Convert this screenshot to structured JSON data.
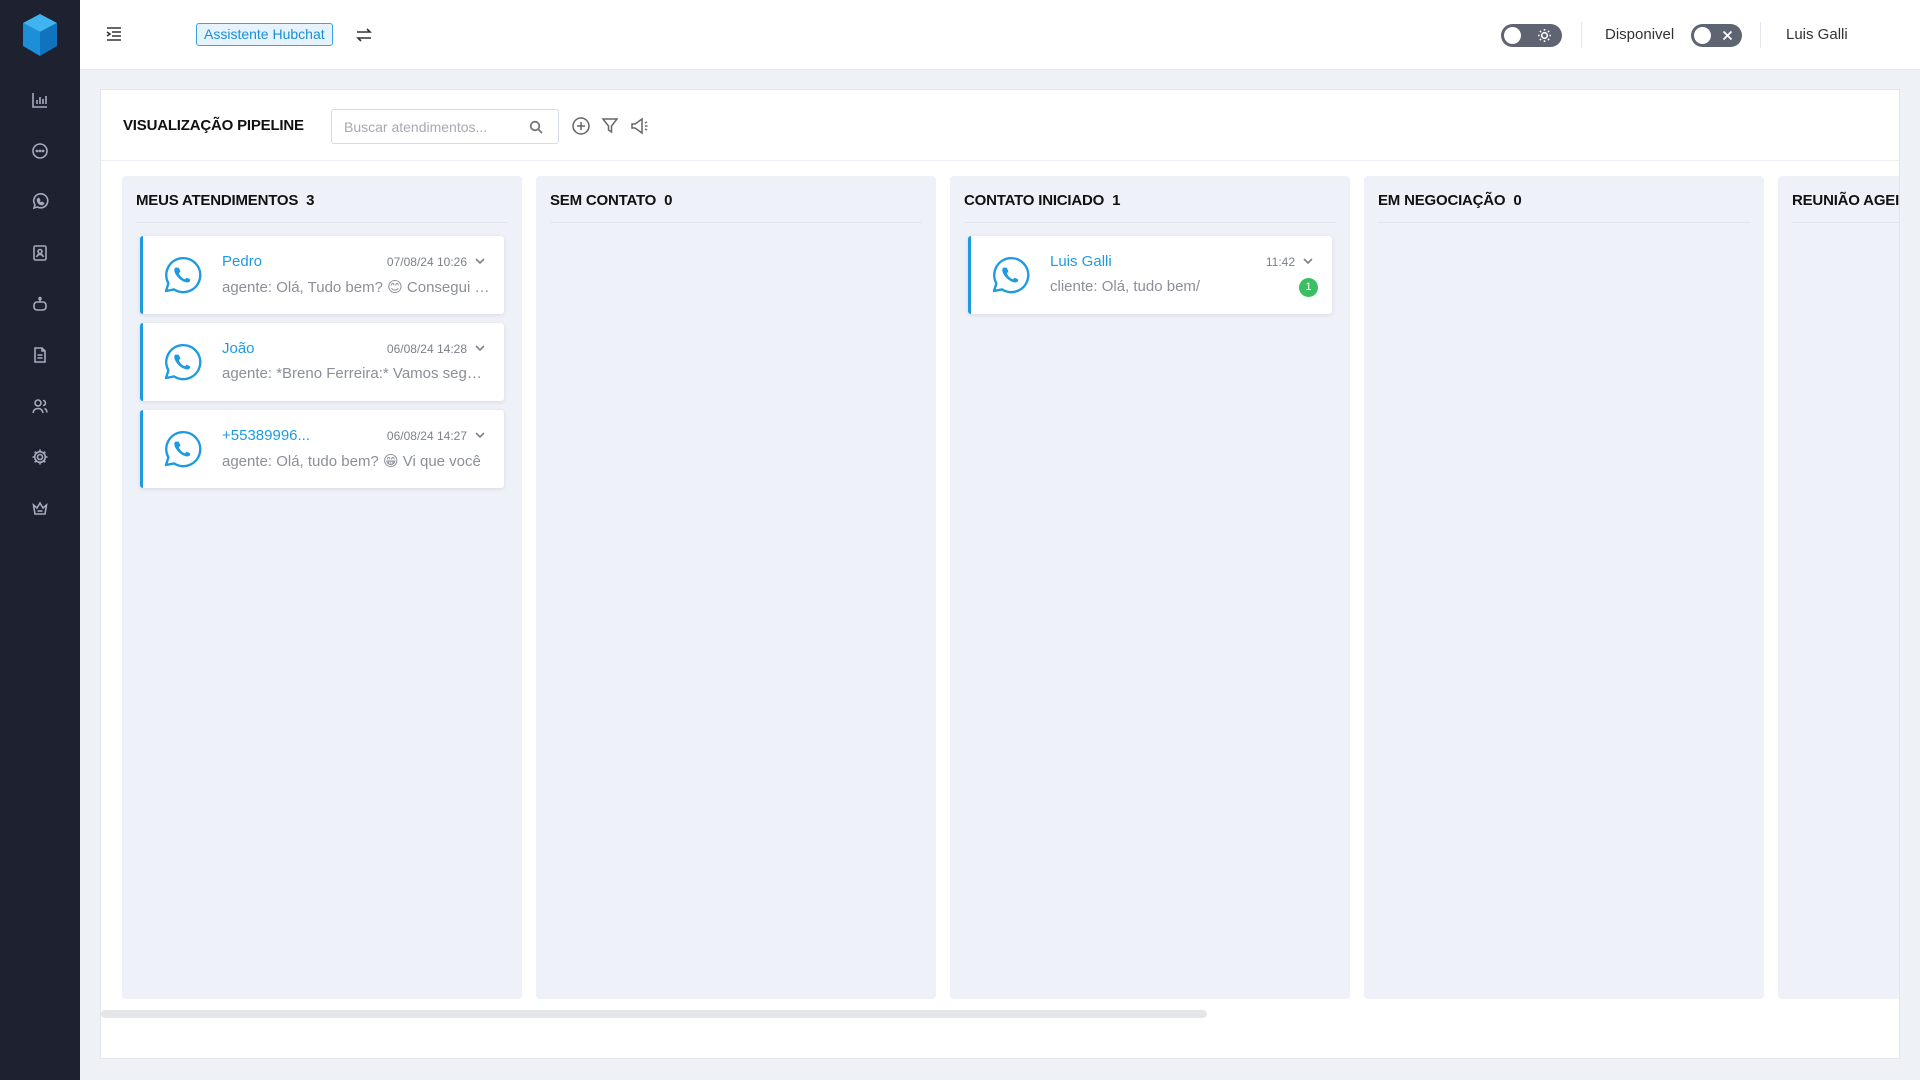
{
  "sidebar": {
    "items": [
      {
        "name": "sidebar-item-dashboard",
        "icon": "bar-chart-icon"
      },
      {
        "name": "sidebar-item-chats",
        "icon": "chat-bubble-icon"
      },
      {
        "name": "sidebar-item-whatsapp",
        "icon": "whatsapp-icon"
      },
      {
        "name": "sidebar-item-contacts",
        "icon": "contact-card-icon"
      },
      {
        "name": "sidebar-item-bots",
        "icon": "robot-icon"
      },
      {
        "name": "sidebar-item-reports",
        "icon": "document-icon"
      },
      {
        "name": "sidebar-item-users",
        "icon": "users-icon"
      },
      {
        "name": "sidebar-item-settings",
        "icon": "gear-icon"
      },
      {
        "name": "sidebar-item-premium",
        "icon": "crown-icon"
      }
    ]
  },
  "topbar": {
    "assistant_label": "Assistente Hubchat",
    "availability_label": "Disponivel",
    "user_name": "Luis Galli"
  },
  "header": {
    "title": "VISUALIZAÇÃO PIPELINE",
    "search_placeholder": "Buscar atendimentos..."
  },
  "columns": [
    {
      "title": "MEUS ATENDIMENTOS",
      "count": "3",
      "cards": [
        {
          "contact": "Pedro",
          "time": "07/08/24 10:26",
          "preview": "agente: Olá, Tudo bem? 😊 Consegui te ajudar?"
        },
        {
          "contact": "João",
          "time": "06/08/24 14:28",
          "preview": "agente: *Breno Ferreira:* Vamos seguir?"
        },
        {
          "contact": "+55389996...",
          "time": "06/08/24 14:27",
          "preview": "agente: Olá, tudo bem? 😁 Vi que você"
        }
      ]
    },
    {
      "title": "SEM CONTATO",
      "count": "0",
      "cards": []
    },
    {
      "title": "CONTATO INICIADO",
      "count": "1",
      "cards": [
        {
          "contact": "Luis Galli",
          "time": "11:42",
          "preview": "cliente: Olá, tudo bem/",
          "unread": "1"
        }
      ]
    },
    {
      "title": "EM NEGOCIAÇÃO",
      "count": "0",
      "cards": []
    },
    {
      "title": "REUNIÃO AGEI",
      "count": "",
      "cards": []
    }
  ],
  "colors": {
    "accent": "#1e9be0",
    "sidebar_bg": "#1e2130",
    "column_bg": "#eef1f8",
    "unread_badge": "#3cbf63"
  }
}
